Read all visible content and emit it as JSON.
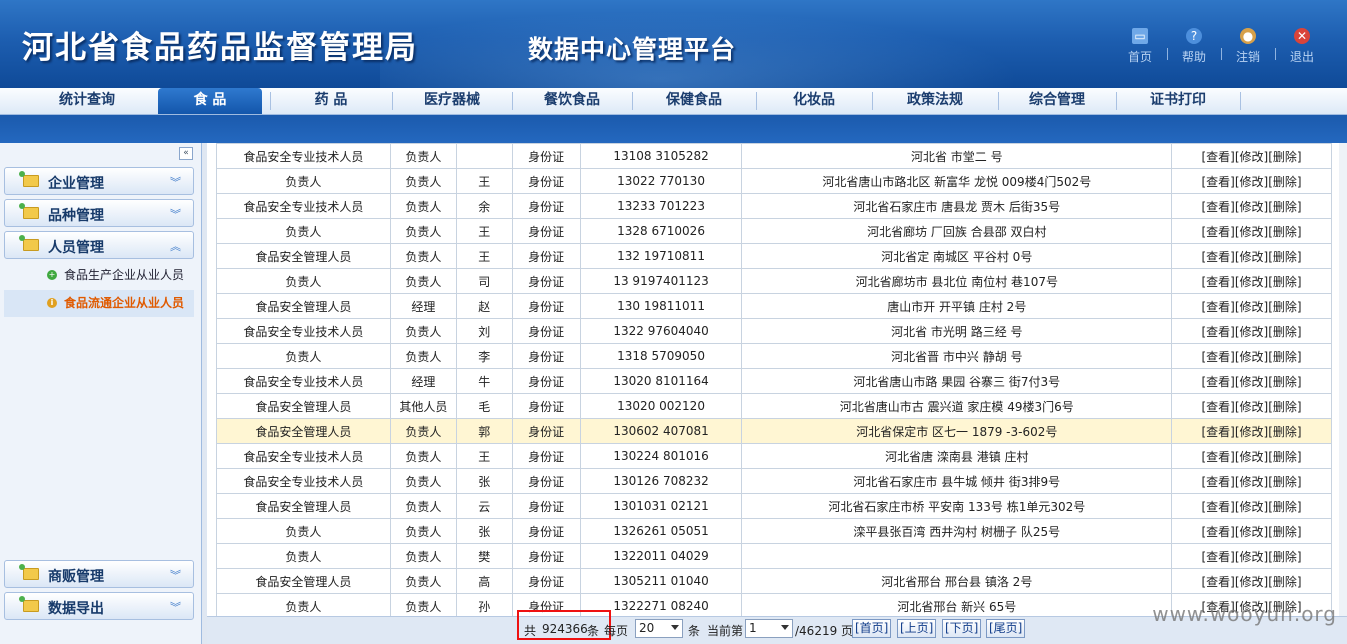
{
  "header": {
    "title": "河北省食品药品监督管理局",
    "subtitle": "数据中心管理平台",
    "links": [
      {
        "label": "首页",
        "icon": "home-icon"
      },
      {
        "label": "帮助",
        "icon": "help-icon"
      },
      {
        "label": "注销",
        "icon": "logout-icon"
      },
      {
        "label": "退出",
        "icon": "exit-icon"
      }
    ]
  },
  "nav": {
    "tabs": [
      "统计查询",
      "食 品",
      "药 品",
      "医疗器械",
      "餐饮食品",
      "保健食品",
      "化妆品",
      "政策法规",
      "综合管理",
      "证书打印"
    ],
    "active": "食 品"
  },
  "sidebar": {
    "sections": [
      {
        "label": "企业管理"
      },
      {
        "label": "品种管理"
      },
      {
        "label": "人员管理"
      },
      {
        "label": "商贩管理"
      },
      {
        "label": "数据导出"
      }
    ],
    "subitems": [
      {
        "label": "食品生产企业从业人员"
      },
      {
        "label": "食品流通企业从业人员"
      }
    ]
  },
  "table": {
    "ops": [
      "[查看]",
      "[修改]",
      "[删除]"
    ],
    "rows": [
      {
        "role": "食品安全专业技术人员",
        "position": "负责人",
        "name": "",
        "idtype": "身份证",
        "idno": "13108  3105282",
        "addr": "河北省 市堂二 号"
      },
      {
        "role": "负责人",
        "position": "负责人",
        "name": "王",
        "idtype": "身份证",
        "idno": "13022  770130",
        "addr": "河北省唐山市路北区 新富华 龙悦 009楼4门502号"
      },
      {
        "role": "食品安全专业技术人员",
        "position": "负责人",
        "name": "余",
        "idtype": "身份证",
        "idno": "13233  701223",
        "addr": "河北省石家庄市 唐县龙 贾木 后街35号"
      },
      {
        "role": "负责人",
        "position": "负责人",
        "name": "王",
        "idtype": "身份证",
        "idno": "1328  6710026",
        "addr": "河北省廊坊 厂回族 合县邵 双白村"
      },
      {
        "role": "食品安全管理人员",
        "position": "负责人",
        "name": "王",
        "idtype": "身份证",
        "idno": "132  19710811",
        "addr": "河北省定 南城区 平谷村 0号"
      },
      {
        "role": "负责人",
        "position": "负责人",
        "name": "司",
        "idtype": "身份证",
        "idno": "13  9197401123",
        "addr": "河北省廊坊市 县北位 南位村 巷107号"
      },
      {
        "role": "食品安全管理人员",
        "position": "经理",
        "name": "赵",
        "idtype": "身份证",
        "idno": "130  19811011",
        "addr": "唐山市开 开平镇 庄村 2号"
      },
      {
        "role": "食品安全专业技术人员",
        "position": "负责人",
        "name": "刘",
        "idtype": "身份证",
        "idno": "1322  97604040",
        "addr": "河北省 市光明 路三经 号"
      },
      {
        "role": "负责人",
        "position": "负责人",
        "name": "李",
        "idtype": "身份证",
        "idno": "1318  5709050",
        "addr": "河北省晋 市中兴 静胡 号"
      },
      {
        "role": "食品安全专业技术人员",
        "position": "经理",
        "name": "牛",
        "idtype": "身份证",
        "idno": "13020  8101164",
        "addr": "河北省唐山市路 果园 谷寨三 街7付3号"
      },
      {
        "role": "食品安全管理人员",
        "position": "其他人员",
        "name": "毛",
        "idtype": "身份证",
        "idno": "13020  002120",
        "addr": "河北省唐山市古 震兴道 家庄模 49楼3门6号"
      },
      {
        "role": "食品安全管理人员",
        "position": "负责人",
        "name": "郭",
        "idtype": "身份证",
        "idno": "130602  407081",
        "addr": "河北省保定市 区七一 1879 -3-602号"
      },
      {
        "role": "食品安全专业技术人员",
        "position": "负责人",
        "name": "王",
        "idtype": "身份证",
        "idno": "130224  801016",
        "addr": "河北省唐 滦南县 港镇 庄村"
      },
      {
        "role": "食品安全专业技术人员",
        "position": "负责人",
        "name": "张",
        "idtype": "身份证",
        "idno": "130126  708232",
        "addr": "河北省石家庄市 县牛城 倾井 街3排9号"
      },
      {
        "role": "食品安全管理人员",
        "position": "负责人",
        "name": "云",
        "idtype": "身份证",
        "idno": "1301031  02121",
        "addr": "河北省石家庄市桥 平安南 133号 栋1单元302号"
      },
      {
        "role": "负责人",
        "position": "负责人",
        "name": "张",
        "idtype": "身份证",
        "idno": "1326261  05051",
        "addr": "滦平县张百湾 西井沟村 树栅子 队25号"
      },
      {
        "role": "负责人",
        "position": "负责人",
        "name": "樊",
        "idtype": "身份证",
        "idno": "1322011  04029",
        "addr": ""
      },
      {
        "role": "食品安全管理人员",
        "position": "负责人",
        "name": "高",
        "idtype": "身份证",
        "idno": "1305211  01040",
        "addr": "河北省邢台 邢台县 镇洛 2号"
      },
      {
        "role": "负责人",
        "position": "负责人",
        "name": "孙",
        "idtype": "身份证",
        "idno": "1322271  08240",
        "addr": "河北省邢台 新兴 65号"
      }
    ],
    "highlight_row": 11
  },
  "pager": {
    "total_prefix": "共",
    "total": "924366",
    "total_suffix": "条",
    "per_page_label": "每页",
    "per_page_value": "20",
    "per_page_unit": "条",
    "current_label": "当前第",
    "current_value": "1",
    "pages_text": "/46219 页",
    "buttons": [
      "[首页]",
      "[上页]",
      "[下页]",
      "[尾页]"
    ]
  },
  "watermark": "www.wooyun.org"
}
